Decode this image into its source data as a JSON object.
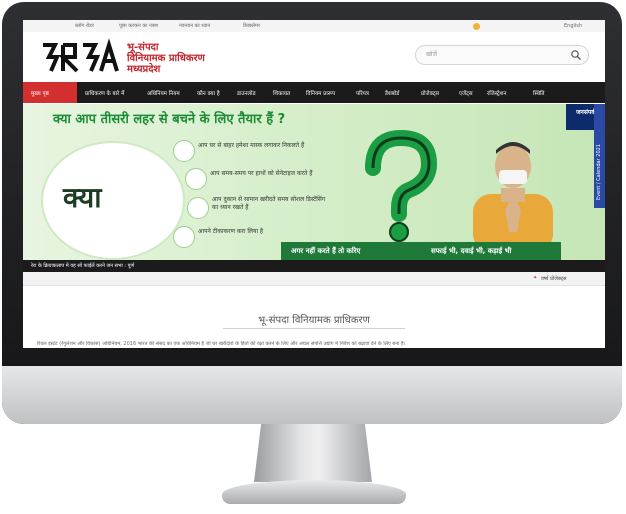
{
  "topbar": {
    "links": [
      "ब्लॉग रोडर",
      "पूछा करकन का नक्श",
      "नवनयन का ध्यान",
      "डिस्क्लेमर"
    ],
    "language": "English"
  },
  "header": {
    "logo_text": "भू-संपदा",
    "org_line1": "भू-संपदा",
    "org_line2": "विनियामक प्राधिकरण",
    "org_line3": "मध्यप्रदेश"
  },
  "search": {
    "placeholder": "खोजें"
  },
  "nav": {
    "items": [
      "मुख्य पृष्ठ",
      "प्राधिकरण के बारे में",
      "अधिनियम नियम",
      "कौन क्या है",
      "डाउनलोड",
      "शिकायत",
      "विनियम प्रारूप",
      "परिपत्र",
      "डैशबोर्ड",
      "प्रोजेक्ट्स",
      "एजेंट्स",
      "रजिस्ट्रेशन",
      "स्थिति"
    ]
  },
  "banner": {
    "title": "क्या आप तीसरी लहर से बचने के लिए तैयार हैं ?",
    "kya": "क्या",
    "items": [
      "आप घर से बाहर हमेशा मास्क लगाकर निकलते हैं",
      "आप समय-समय पर हाथों को सेनेटाइज करते हैं",
      "आप दुकान से सामान खरीदते समय सोशल डिस्टेंसिंग का ध्यान रखते हैं",
      "आपने टीकाकरण करा लिया है"
    ],
    "strip_left": "अगर नहीं करते हैं तो करिए",
    "strip_right": "सफाई भी, दवाई भी, कड़ाई भी",
    "badge": "जनसंपर्क",
    "vertical_tab": "Event / Calendar 2021"
  },
  "ticker": {
    "text": "रेरा के क्रियाकलाप में यह सो फाईलें करने जन सभा : पूर्ण"
  },
  "news": {
    "text": "वर्ष्य प्रोजेक्ट्स"
  },
  "content": {
    "heading": "भू-संपदा विनियामक प्राधिकरण",
    "paragraph": "रियल इस्टेट (रेगुलेशन और विकास) अधिनियम, 2016 भारत की संसद का एक अधिनियम है जो घर खरीदारों के हितों की रक्षा करने के लिए और अचल संपत्ति उद्योग में निवेश को बढ़ावा देने के लिए बना है।"
  },
  "colors": {
    "nav_active": "#d32f2f",
    "brand_red": "#c0272d",
    "banner_green": "#1d8c36"
  }
}
